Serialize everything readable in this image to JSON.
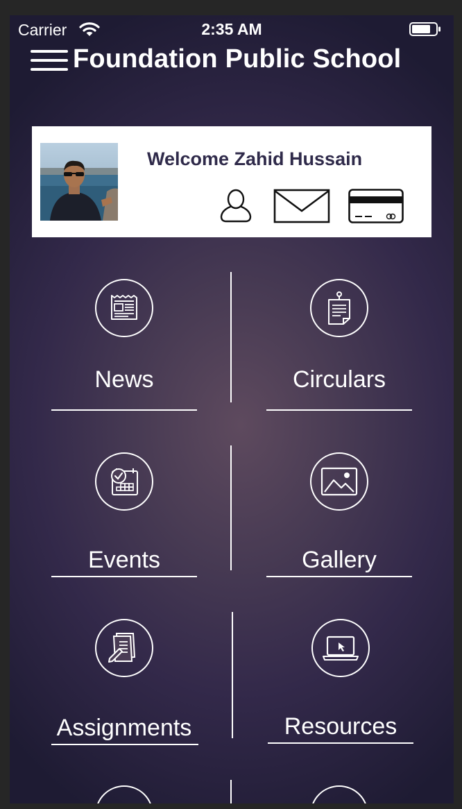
{
  "status_bar": {
    "carrier": "Carrier",
    "time": "2:35 AM"
  },
  "header": {
    "title": "Foundation Public School"
  },
  "welcome": {
    "text": "Welcome Zahid Hussain"
  },
  "tiles": [
    {
      "label": "News",
      "icon": "newspaper-icon"
    },
    {
      "label": "Circulars",
      "icon": "notice-icon"
    },
    {
      "label": "Events",
      "icon": "calendar-icon"
    },
    {
      "label": "Gallery",
      "icon": "image-icon"
    },
    {
      "label": "Assignments",
      "icon": "document-pencil-icon"
    },
    {
      "label": "Resources",
      "icon": "laptop-icon"
    }
  ],
  "colors": {
    "card_text": "#2f2a4a",
    "background_top": "#2e2746",
    "background_center": "#5e4a5e"
  }
}
